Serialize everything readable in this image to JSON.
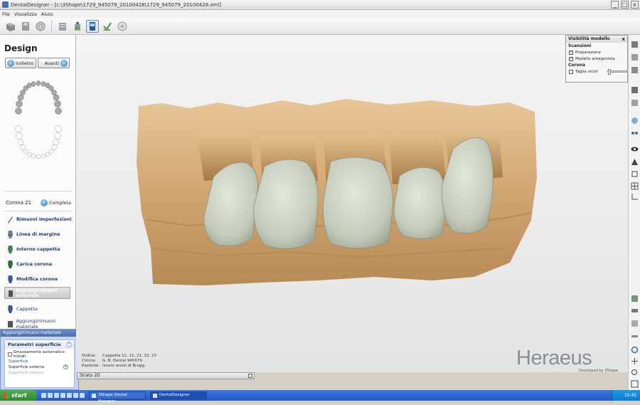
{
  "window": {
    "title": "DentalDesigner - [c:\\3Shape\\1729_945079_20100428\\1729_945079_20100428.xml]",
    "controls": [
      "_",
      "□",
      "x"
    ]
  },
  "menu": [
    "File",
    "Visualizza",
    "Aiuto"
  ],
  "toolbar": {
    "icons": [
      "open-icon",
      "save-icon",
      "disc-icon",
      "order-icon",
      "bottle-icon",
      "scanner-icon",
      "check-icon",
      "cd-icon"
    ]
  },
  "left_panel": {
    "title": "Design",
    "back_label": "Indietro",
    "next_label": "Avanti",
    "crown_label": "Corona 21",
    "complete_label": "Completa",
    "steps": [
      {
        "label": "Rimuovi imperfezioni",
        "icon": "brush-icon"
      },
      {
        "label": "Linea di margine",
        "icon": "tooth-margin-icon"
      },
      {
        "label": "Interno cappetta",
        "icon": "tooth-inner-icon"
      },
      {
        "label": "Carica corona",
        "icon": "crown-load-icon"
      },
      {
        "label": "Modifica corona",
        "icon": "crown-edit-icon"
      },
      {
        "label": "Aggiungi/rimuovi materiale",
        "icon": "material-icon",
        "selected": true
      },
      {
        "label": "Cappetta",
        "icon": "coping-icon"
      },
      {
        "label": "Aggiungi/rimuovi materiale",
        "icon": "material-icon"
      }
    ]
  },
  "float_panel": {
    "title": "Aggiungi/rimuovi materiale",
    "section": "Parametri superficie",
    "checkbox_label": "Smussamento automatico iniziali",
    "links": [
      "Superficie",
      "Superficie esterna",
      "Superficie interna"
    ]
  },
  "visibility_panel": {
    "title": "Visibilità modello",
    "close": "x",
    "section_scans": "Scansioni",
    "prep_label": "Preparazione",
    "prep_checked": true,
    "antagonist_label": "Modello antagonista",
    "antagonist_checked": true,
    "section_crown": "Corona",
    "neighbors_label": "Taglia vicini",
    "neighbors_checked": false
  },
  "order_info": {
    "order_key": "Ordine:",
    "order_val": "Cappetta 12, 11, 21, 22, 23",
    "clinic_key": "Clinica:",
    "clinic_val": "G. B. Dental 945079",
    "patient_key": "Paziente:",
    "patient_val": "lavoro arxiol di Brugg,"
  },
  "strato": "Strato 2D",
  "brand": {
    "logo": "Heraeus",
    "sub": "Developed by 3Shape"
  },
  "taskbar": {
    "start": "start",
    "tasks": [
      "3Shape Dental Manager",
      "DentalDesigner"
    ],
    "clock": "10.45"
  },
  "colors": {
    "gypsum": "#d6ac76",
    "crown": "#cfd4c6",
    "xp_blue": "#2458c6"
  }
}
